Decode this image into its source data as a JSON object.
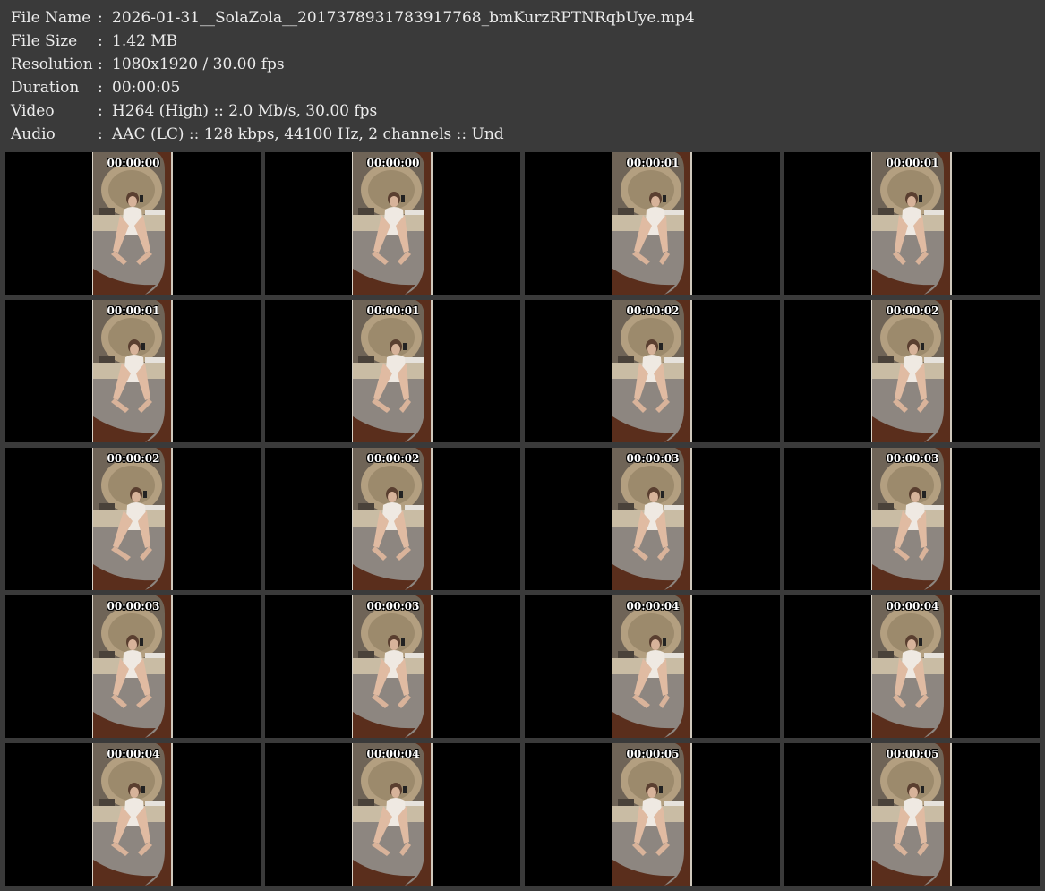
{
  "info": [
    {
      "key": "File Name",
      "sep": ":",
      "value": "2026-01-31__SolaZola__2017378931783917768_bmKurzRPTNRqbUye.mp4"
    },
    {
      "key": "File Size",
      "sep": ":",
      "value": "1.42 MB"
    },
    {
      "key": "Resolution",
      "sep": ":",
      "value": "1080x1920 / 30.00 fps"
    },
    {
      "key": "Duration",
      "sep": ":",
      "value": "00:00:05"
    },
    {
      "key": "Video",
      "sep": ":",
      "value": "H264 (High) :: 2.0 Mb/s, 30.00 fps"
    },
    {
      "key": "Audio",
      "sep": ":",
      "value": "AAC (LC) :: 128 kbps, 44100 Hz, 2 channels :: Und"
    }
  ],
  "thumbnails": [
    {
      "timestamp": "00:00:00"
    },
    {
      "timestamp": "00:00:00"
    },
    {
      "timestamp": "00:00:01"
    },
    {
      "timestamp": "00:00:01"
    },
    {
      "timestamp": "00:00:01"
    },
    {
      "timestamp": "00:00:01"
    },
    {
      "timestamp": "00:00:02"
    },
    {
      "timestamp": "00:00:02"
    },
    {
      "timestamp": "00:00:02"
    },
    {
      "timestamp": "00:00:02"
    },
    {
      "timestamp": "00:00:03"
    },
    {
      "timestamp": "00:00:03"
    },
    {
      "timestamp": "00:00:03"
    },
    {
      "timestamp": "00:00:03"
    },
    {
      "timestamp": "00:00:04"
    },
    {
      "timestamp": "00:00:04"
    },
    {
      "timestamp": "00:00:04"
    },
    {
      "timestamp": "00:00:04"
    },
    {
      "timestamp": "00:00:05"
    },
    {
      "timestamp": "00:00:05"
    }
  ],
  "colors": {
    "background": "#3a3a3a",
    "cell": "#000000",
    "text": "#ececec",
    "mirror_frame": "#5a2e1c",
    "wall": "#b39f80",
    "floor": "#8d8680"
  }
}
